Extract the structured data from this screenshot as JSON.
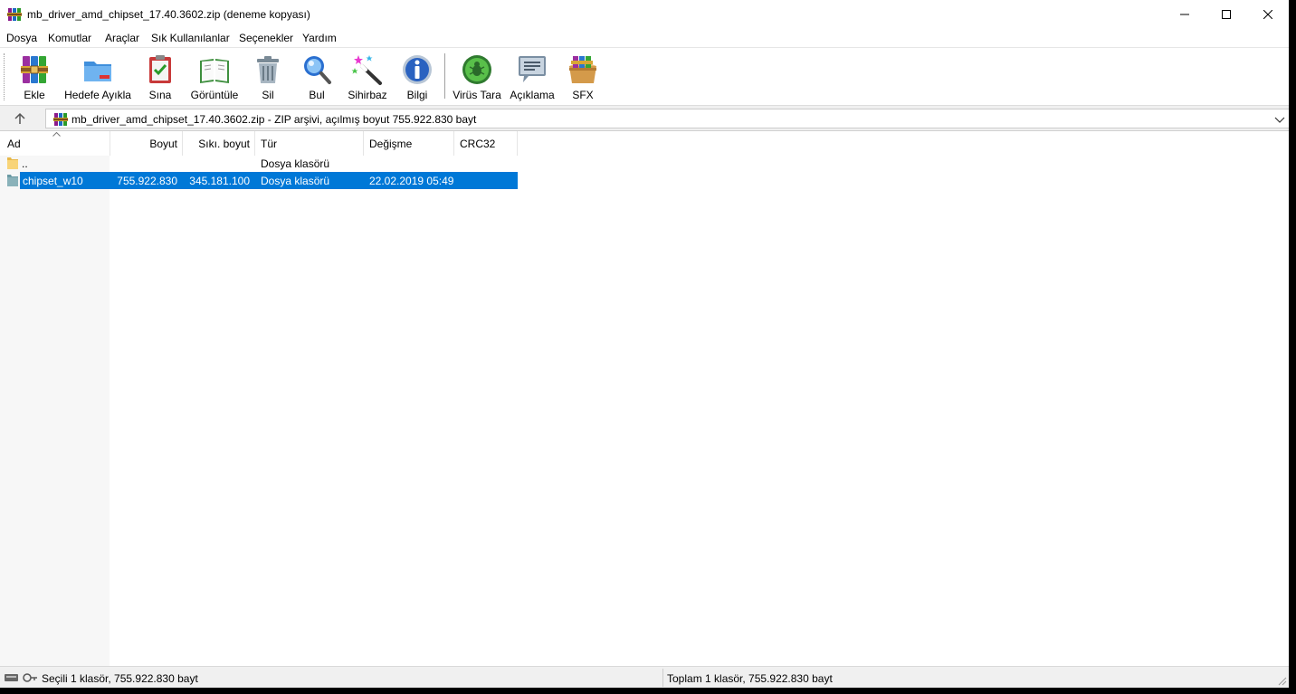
{
  "window": {
    "title": "mb_driver_amd_chipset_17.40.3602.zip (deneme kopyası)"
  },
  "menu": [
    "Dosya",
    "Komutlar",
    "Araçlar",
    "Sık Kullanılanlar",
    "Seçenekler",
    "Yardım"
  ],
  "toolbar": [
    {
      "label": "Ekle",
      "icon": "add-archive-icon"
    },
    {
      "label": "Hedefe Ayıkla",
      "icon": "extract-to-icon"
    },
    {
      "label": "Sına",
      "icon": "test-icon"
    },
    {
      "label": "Görüntüle",
      "icon": "view-book-icon"
    },
    {
      "label": "Sil",
      "icon": "delete-trash-icon"
    },
    {
      "label": "Bul",
      "icon": "find-magnifier-icon"
    },
    {
      "label": "Sihirbaz",
      "icon": "wizard-wand-icon"
    },
    {
      "label": "Bilgi",
      "icon": "info-icon"
    },
    {
      "label": "Virüs Tara",
      "icon": "virus-scan-icon"
    },
    {
      "label": "Açıklama",
      "icon": "comment-icon"
    },
    {
      "label": "SFX",
      "icon": "sfx-box-icon"
    }
  ],
  "address": {
    "text": "mb_driver_amd_chipset_17.40.3602.zip - ZIP arşivi, açılmış boyut 755.922.830 bayt"
  },
  "columns": {
    "name": "Ad",
    "size": "Boyut",
    "packed": "Sıkı. boyut",
    "type": "Tür",
    "modified": "Değişme",
    "crc": "CRC32"
  },
  "rows": [
    {
      "name": "..",
      "size": "",
      "packed": "",
      "type": "Dosya klasörü",
      "modified": "",
      "crc": "",
      "selected": false
    },
    {
      "name": "chipset_w10",
      "size": "755.922.830",
      "packed": "345.181.100",
      "type": "Dosya klasörü",
      "modified": "22.02.2019 05:49",
      "crc": "",
      "selected": true
    }
  ],
  "status": {
    "left": "Seçili 1 klasör, 755.922.830 bayt",
    "right": "Toplam 1 klasör, 755.922.830 bayt"
  },
  "colors": {
    "selection": "#0078d7",
    "background": "#ffffff",
    "bar": "#f0f0f0"
  }
}
